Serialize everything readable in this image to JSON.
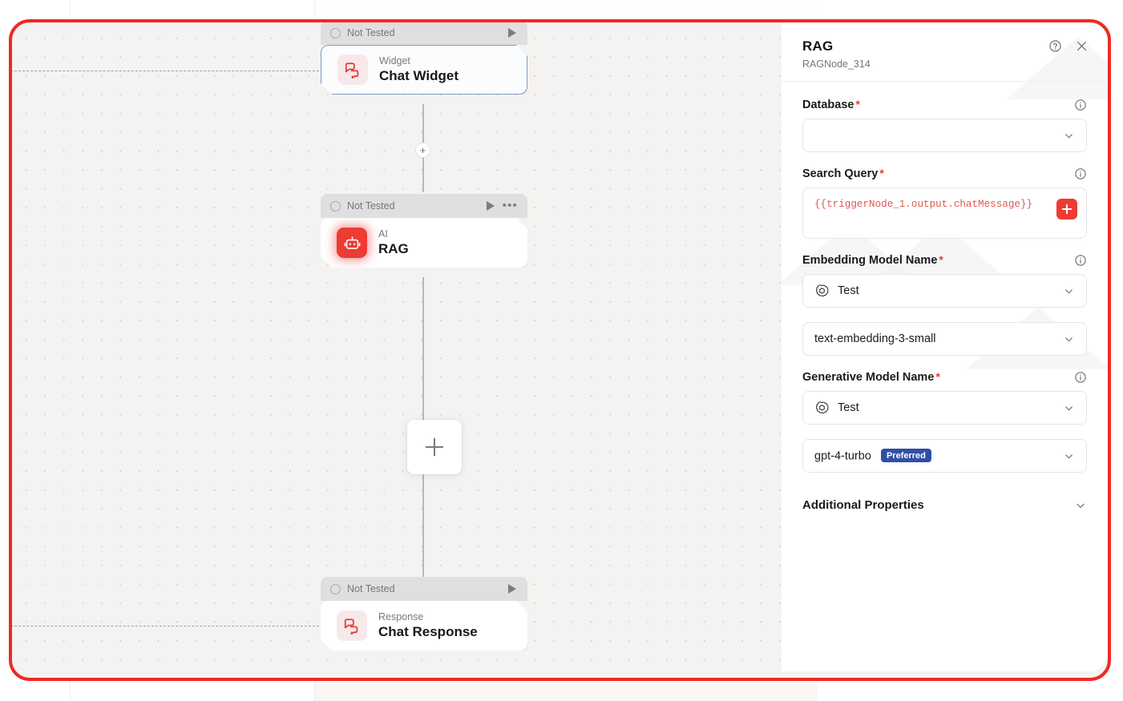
{
  "canvas": {
    "add_node_button_label": "+",
    "connector_plus_label": "+",
    "nodes": [
      {
        "id": "chat-widget",
        "status": "Not Tested",
        "kind": "Widget",
        "title": "Chat Widget",
        "icon": "chat-bubbles-icon",
        "selected": true,
        "has_play": true,
        "has_more": false
      },
      {
        "id": "rag",
        "status": "Not Tested",
        "kind": "AI",
        "title": "RAG",
        "icon": "robot-icon",
        "selected": false,
        "has_play": true,
        "has_more": true
      },
      {
        "id": "chat-response",
        "status": "Not Tested",
        "kind": "Response",
        "title": "Chat Response",
        "icon": "chat-bubbles-icon",
        "selected": false,
        "has_play": true,
        "has_more": false
      }
    ]
  },
  "panel": {
    "title": "RAG",
    "subtitle": "RAGNode_314",
    "help_icon": "question-circle-icon",
    "close_icon": "close-icon",
    "fields": {
      "database": {
        "label": "Database",
        "required_marker": "*",
        "info_icon": "info-icon",
        "value": "",
        "placeholder": ""
      },
      "search_query": {
        "label": "Search Query",
        "required_marker": "*",
        "info_icon": "info-icon",
        "value": "{{triggerNode_1.output.chatMessage}}",
        "add_button_icon": "plus-icon"
      },
      "embedding_model": {
        "label": "Embedding Model Name",
        "required_marker": "*",
        "info_icon": "info-icon",
        "connection_value": "Test",
        "connection_icon": "openai-icon",
        "model_value": "text-embedding-3-small"
      },
      "generative_model": {
        "label": "Generative Model Name",
        "required_marker": "*",
        "info_icon": "info-icon",
        "connection_value": "Test",
        "connection_icon": "openai-icon",
        "model_value": "gpt-4-turbo",
        "model_badge": "Preferred"
      },
      "additional_properties": {
        "label": "Additional Properties",
        "chevron_icon": "chevron-down-icon"
      }
    }
  },
  "colors": {
    "frame_red": "#ee2a24",
    "accent_red": "#ee3b33",
    "badge_blue": "#2f4fa6",
    "canvas_bg": "#f4f3f1",
    "selected_border": "#7a9ec4"
  }
}
